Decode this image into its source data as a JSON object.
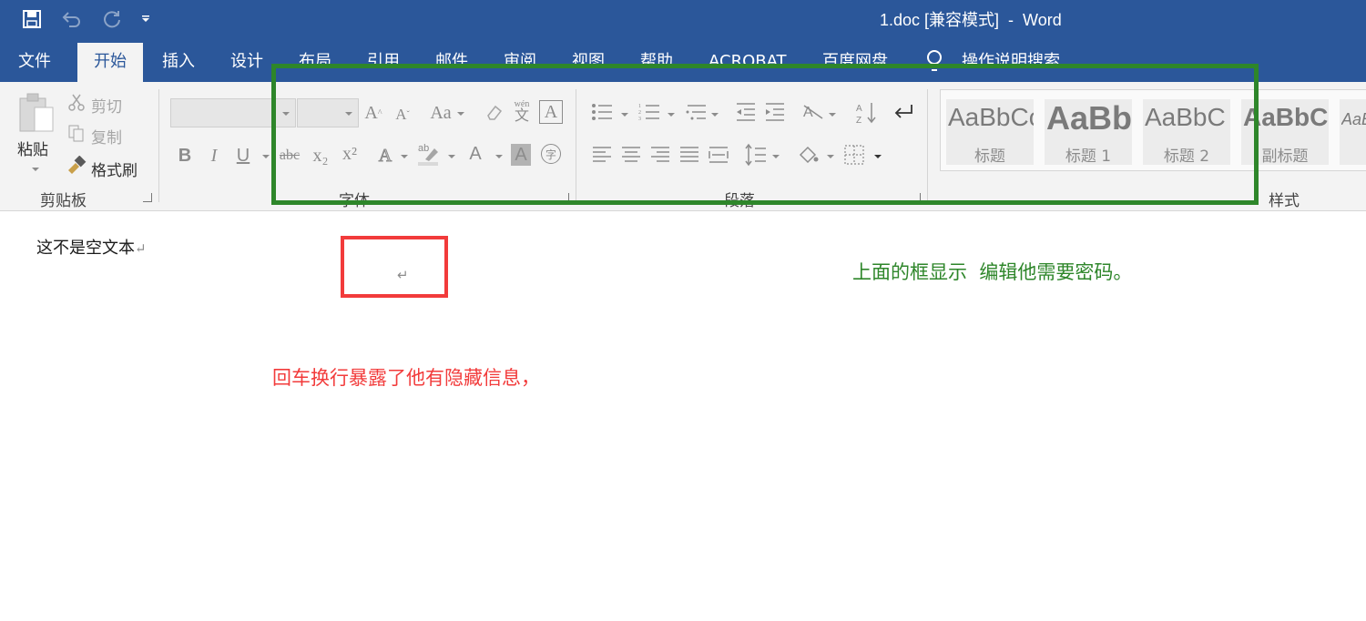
{
  "title_bar": {
    "document_title": "1.doc [兼容模式]  -  Word",
    "quick_access": [
      "save-icon",
      "undo-icon",
      "redo-icon",
      "customize-icon"
    ]
  },
  "tabs": [
    {
      "label": "文件"
    },
    {
      "label": "开始"
    },
    {
      "label": "插入"
    },
    {
      "label": "设计"
    },
    {
      "label": "布局"
    },
    {
      "label": "引用"
    },
    {
      "label": "邮件"
    },
    {
      "label": "审阅"
    },
    {
      "label": "视图"
    },
    {
      "label": "帮助"
    },
    {
      "label": "ACROBAT"
    },
    {
      "label": "百度网盘"
    },
    {
      "label": "操作说明搜索"
    }
  ],
  "ribbon": {
    "clipboard": {
      "paste": "粘贴",
      "cut": "剪切",
      "copy": "复制",
      "format_painter": "格式刷",
      "group_label": "剪贴板"
    },
    "font": {
      "group_label": "字体",
      "font_name": "",
      "font_size": "",
      "bold": "B",
      "italic": "I",
      "underline": "U",
      "strike": "abc",
      "sub": "x₂",
      "sup": "x²",
      "text_effect": "A",
      "font_color": "A",
      "shading": "A",
      "enclose": "字",
      "case": "Aa",
      "phonetic_top": "wén",
      "phonetic_bottom": "文",
      "border_char": "A"
    },
    "paragraph": {
      "group_label": "段落"
    },
    "styles": {
      "group_label": "样式",
      "items": [
        {
          "preview": "AaBbCc",
          "name": "标题"
        },
        {
          "preview": "AaBb",
          "name": "标题 1"
        },
        {
          "preview": "AaBbC",
          "name": "标题 2"
        },
        {
          "preview": "AaBbCc",
          "name": "副标题"
        },
        {
          "preview": "AaBl",
          "name": ""
        }
      ]
    }
  },
  "document": {
    "body_text": "这不是空文本",
    "paragraph_mark": "↵",
    "annotation_green": "上面的框显示  编辑他需要密码。",
    "annotation_red": "回车换行暴露了他有隐藏信息，"
  },
  "colors": {
    "title_bar": "#2b579a",
    "annotation_green": "#2e862a",
    "annotation_red": "#f23b3b",
    "ribbon_bg": "#f3f3f3"
  }
}
